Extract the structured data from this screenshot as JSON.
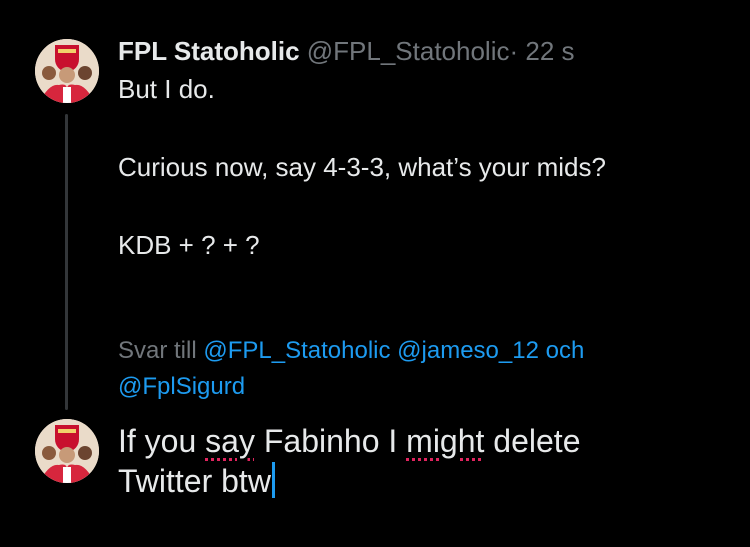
{
  "tweet": {
    "display_name": "FPL Statoholic",
    "handle": "@FPL_Statoholic",
    "separator": "·",
    "time": "22 s",
    "lines": [
      "But I do.",
      "Curious now, say 4-3-3, what’s your mids?",
      "KDB + ? + ?"
    ]
  },
  "reply": {
    "prefix": "Svar till",
    "mentions": [
      "@FPL_Statoholic",
      "@jameso_12",
      "och",
      "@FplSigurd"
    ]
  },
  "compose": {
    "text_parts": [
      "If you ",
      "say",
      " Fabinho I ",
      "might",
      " delete",
      "Twitter btw"
    ]
  },
  "colors": {
    "background": "#000000",
    "text": "#e7e9ea",
    "muted": "#71767b",
    "accent": "#1d9bf0",
    "spellcheck": "#e0245e"
  },
  "icons": {
    "avatar": "arsenal-fan-avatar"
  }
}
